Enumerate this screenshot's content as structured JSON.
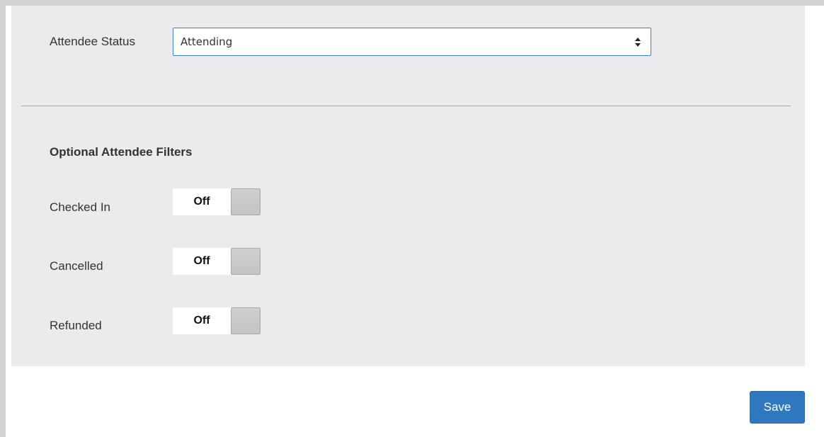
{
  "attendee_status": {
    "label": "Attendee Status",
    "selected": "Attending"
  },
  "filters": {
    "title": "Optional Attendee Filters",
    "items": [
      {
        "label": "Checked In",
        "state": "Off"
      },
      {
        "label": "Cancelled",
        "state": "Off"
      },
      {
        "label": "Refunded",
        "state": "Off"
      }
    ]
  },
  "footer": {
    "save_label": "Save"
  },
  "colors": {
    "accent": "#2f78bd",
    "panel": "#ebebed",
    "select_border": "#3f7fc6"
  }
}
